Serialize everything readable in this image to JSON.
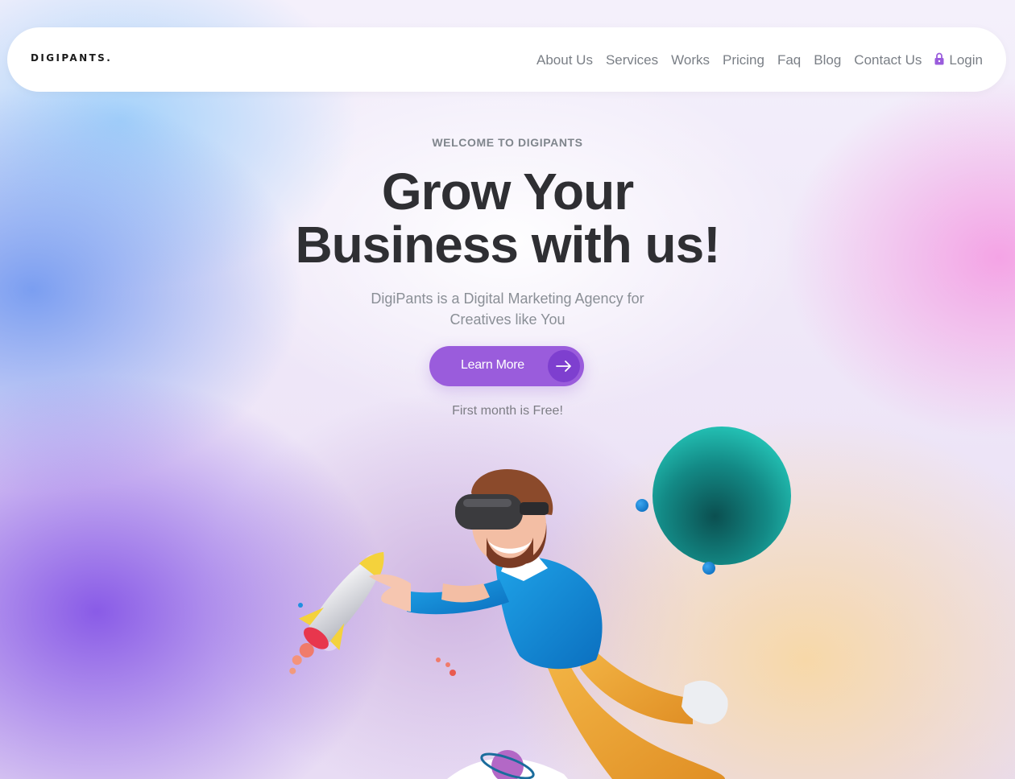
{
  "brand": {
    "logo_text": "DIGIPANTS."
  },
  "nav": {
    "items": [
      {
        "label": "About Us"
      },
      {
        "label": "Services"
      },
      {
        "label": "Works"
      },
      {
        "label": "Pricing"
      },
      {
        "label": "Faq"
      },
      {
        "label": "Blog"
      },
      {
        "label": "Contact Us"
      }
    ],
    "login": {
      "label": "Login",
      "icon": "lock-icon"
    }
  },
  "hero": {
    "eyebrow": "WELCOME TO DIGIPANTS",
    "headline_line1": "Grow Your",
    "headline_line2": "Business with us!",
    "subtext": "DigiPants is a Digital Marketing Agency for Creatives like You",
    "cta_label": "Learn More",
    "cta_icon": "arrow-right-icon",
    "note": "First month is Free!"
  },
  "colors": {
    "accent": "#9a5cdc",
    "accent_dark": "#7e3fcf",
    "headline": "#2f2f33",
    "nav_text": "#7a7f86"
  }
}
